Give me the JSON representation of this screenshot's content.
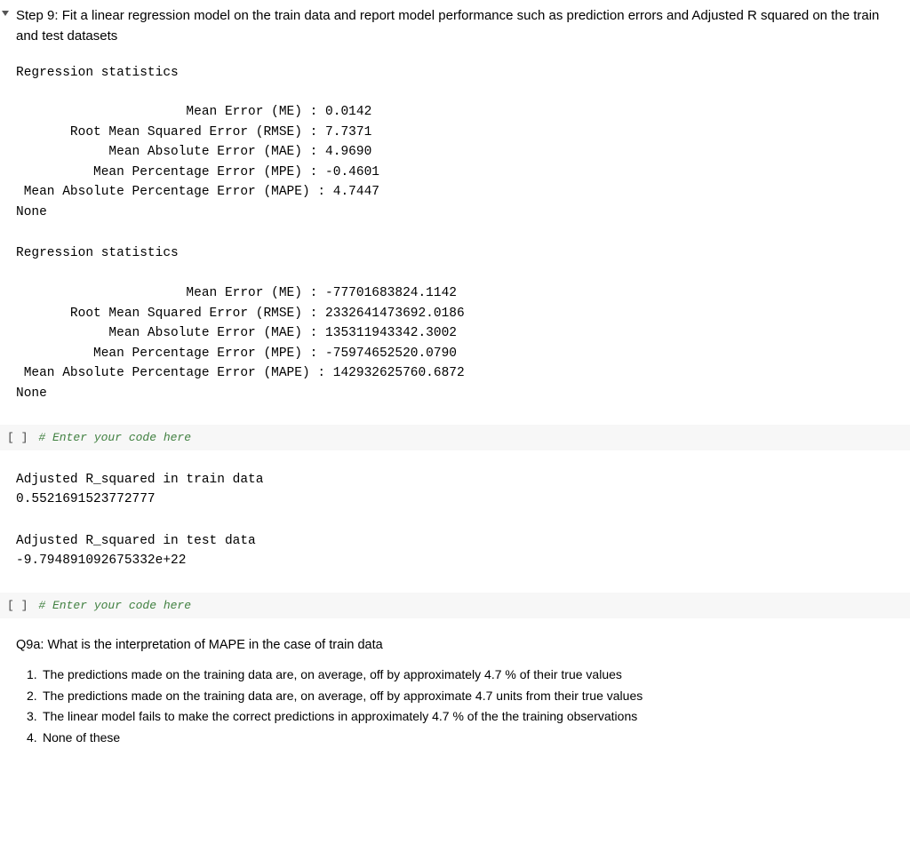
{
  "step": {
    "heading": "Step 9: Fit a linear regression model on the train data and report model performance such as prediction errors and Adjusted R squared on the train and test datasets"
  },
  "stats1": {
    "title": "Regression statistics",
    "rows": [
      {
        "label": "Mean Error (ME)",
        "value": "0.0142"
      },
      {
        "label": "Root Mean Squared Error (RMSE)",
        "value": "7.7371"
      },
      {
        "label": "Mean Absolute Error (MAE)",
        "value": "4.9690"
      },
      {
        "label": "Mean Percentage Error (MPE)",
        "value": "-0.4601"
      },
      {
        "label": "Mean Absolute Percentage Error (MAPE)",
        "value": "4.7447"
      }
    ],
    "trailing": "None"
  },
  "stats2": {
    "title": "Regression statistics",
    "rows": [
      {
        "label": "Mean Error (ME)",
        "value": "-77701683824.1142"
      },
      {
        "label": "Root Mean Squared Error (RMSE)",
        "value": "2332641473692.0186"
      },
      {
        "label": "Mean Absolute Error (MAE)",
        "value": "135311943342.3002"
      },
      {
        "label": "Mean Percentage Error (MPE)",
        "value": "-75974652520.0790"
      },
      {
        "label": "Mean Absolute Percentage Error (MAPE)",
        "value": "142932625760.6872"
      }
    ],
    "trailing": "None"
  },
  "code_cells": {
    "prompt": "[ ]",
    "comment": "# Enter your code here"
  },
  "adj_r2_train": {
    "title": "Adjusted R_squared in train data",
    "value": "0.5521691523772777"
  },
  "adj_r2_test": {
    "title": "Adjusted R_squared in test data",
    "value": "-9.794891092675332e+22"
  },
  "question": {
    "heading": "Q9a: What is the interpretation of MAPE in the case of train data",
    "options": [
      "The predictions made on the training data are, on average, off by approximately 4.7 % of their true values",
      "The predictions made on the training data are, on average, off by approximate 4.7 units from their true values",
      "The linear model fails to make the correct predictions in approximately 4.7 % of the the training observations",
      "None of these"
    ]
  }
}
